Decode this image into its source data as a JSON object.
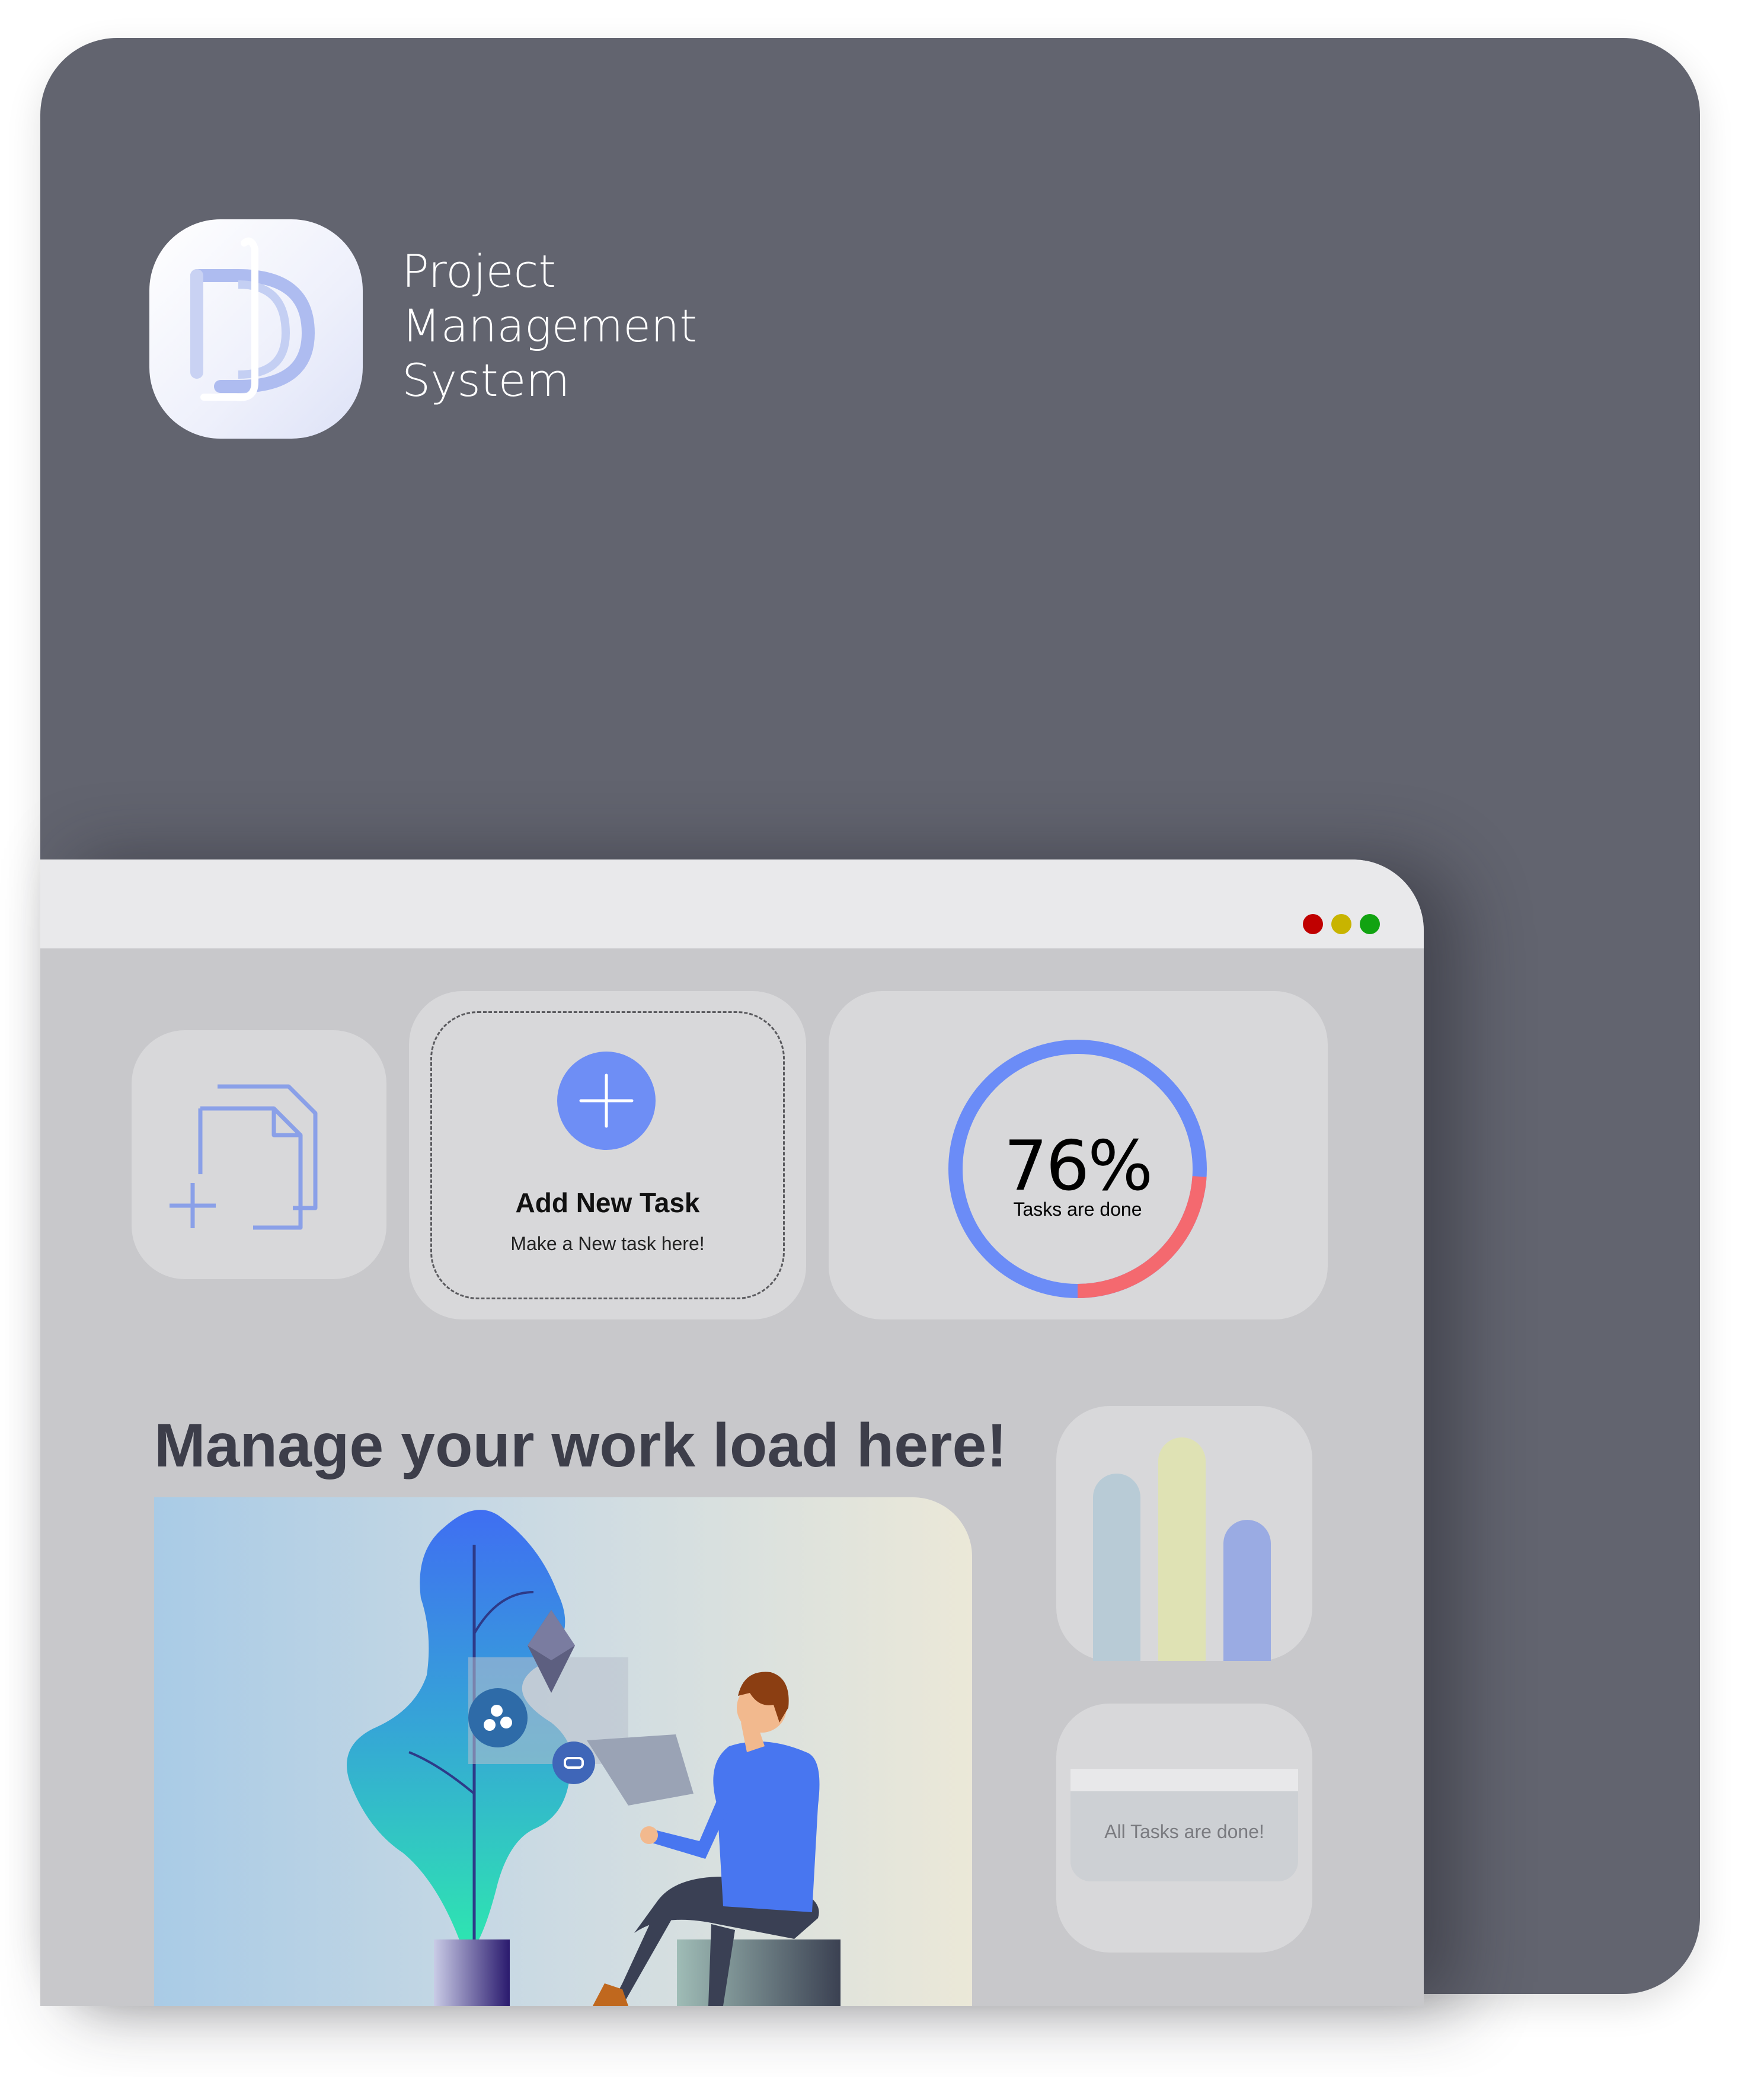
{
  "brand": {
    "lines": [
      "Project",
      "Management",
      "System"
    ],
    "logo_icon": "pm-monogram-logo"
  },
  "window": {
    "controls": [
      "close",
      "minimize",
      "maximize"
    ],
    "control_colors": {
      "close": "#c00000",
      "minimize": "#c8b400",
      "maximize": "#11a311"
    }
  },
  "tiles": {
    "new_document_icon": "add-document-icon",
    "add_task": {
      "title": "Add New Task",
      "subtitle": "Make a New task here!",
      "icon": "plus-icon"
    },
    "progress": {
      "percent_label": "76%",
      "caption": "Tasks are done",
      "done_fraction": 0.76,
      "colors": {
        "done": "#6b8cf7",
        "remaining": "#f4696f"
      }
    }
  },
  "main": {
    "headline": "Manage your work load here!"
  },
  "side": {
    "bar_levels": [
      0.77,
      0.92,
      0.58
    ],
    "bar_colors": [
      "#b8cbd6",
      "#dfe2b4",
      "#9aabe3"
    ],
    "status_message": "All Tasks are done!"
  },
  "colors": {
    "accent": "#6e8ef5",
    "background": "#62646f"
  }
}
